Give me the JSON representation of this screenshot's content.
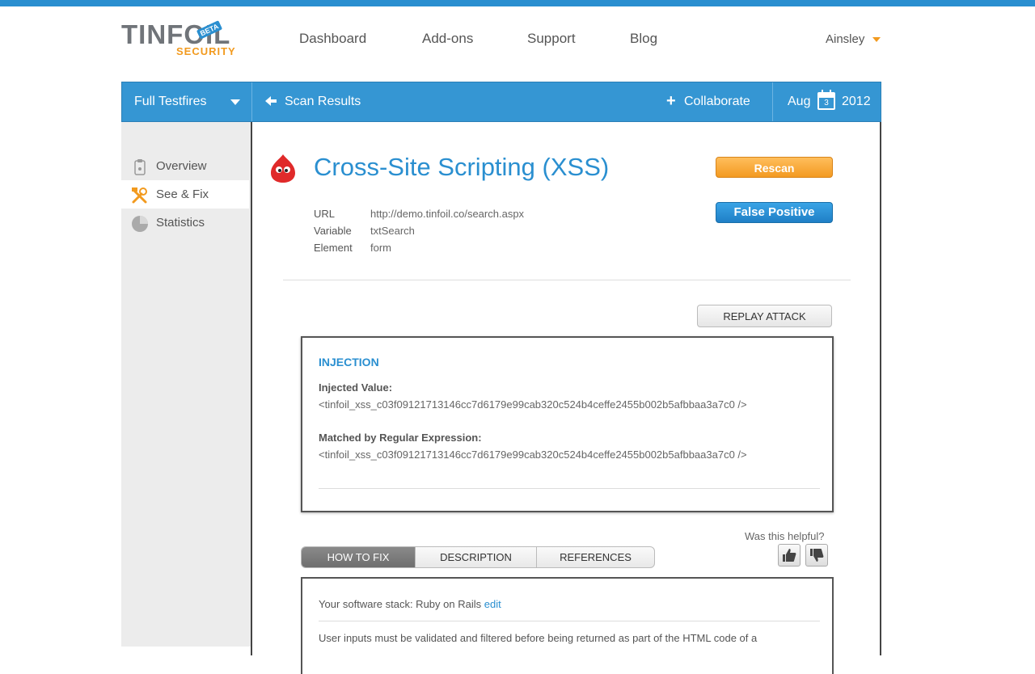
{
  "brand": {
    "name": "TINFOIL",
    "sub": "SECURITY",
    "badge": "BETA"
  },
  "nav": {
    "items": [
      "Dashboard",
      "Add-ons",
      "Support",
      "Blog"
    ],
    "user": "Ainsley"
  },
  "toolbar": {
    "dropdown": "Full Testfires",
    "back": "Scan Results",
    "collaborate": "Collaborate",
    "date_month": "Aug",
    "date_day": "3",
    "date_year": "2012"
  },
  "sidebar": {
    "items": [
      {
        "label": "Overview",
        "icon": "clipboard-icon"
      },
      {
        "label": "See & Fix",
        "icon": "tools-icon",
        "active": true
      },
      {
        "label": "Statistics",
        "icon": "pie-chart-icon"
      }
    ]
  },
  "vuln": {
    "title": "Cross-Site Scripting (XSS)",
    "url_label": "URL",
    "url": "http://demo.tinfoil.co/search.aspx",
    "variable_label": "Variable",
    "variable": "txtSearch",
    "element_label": "Element",
    "element": "form"
  },
  "actions": {
    "rescan": "Rescan",
    "false_positive": "False Positive",
    "replay": "REPLAY ATTACK"
  },
  "injection": {
    "title": "INJECTION",
    "injected_label": "Injected Value:",
    "injected_value": "<tinfoil_xss_c03f09121713146cc7d6179e99cab320c524b4ceffe2455b002b5afbbaa3a7c0 />",
    "matched_label": "Matched by Regular Expression:",
    "matched_value": "<tinfoil_xss_c03f09121713146cc7d6179e99cab320c524b4ceffe2455b002b5afbbaa3a7c0 />"
  },
  "feedback": {
    "question": "Was this helpful?"
  },
  "tabs": [
    "HOW TO FIX",
    "DESCRIPTION",
    "REFERENCES"
  ],
  "fix": {
    "stack_prefix": "Your software stack: Ruby on Rails",
    "edit": "edit",
    "text": "User inputs must be validated and filtered before being returned as part of the HTML code of a"
  },
  "colors": {
    "accent": "#2a8fd0",
    "orange": "#f39a21",
    "vuln_red": "#e02a2a"
  }
}
